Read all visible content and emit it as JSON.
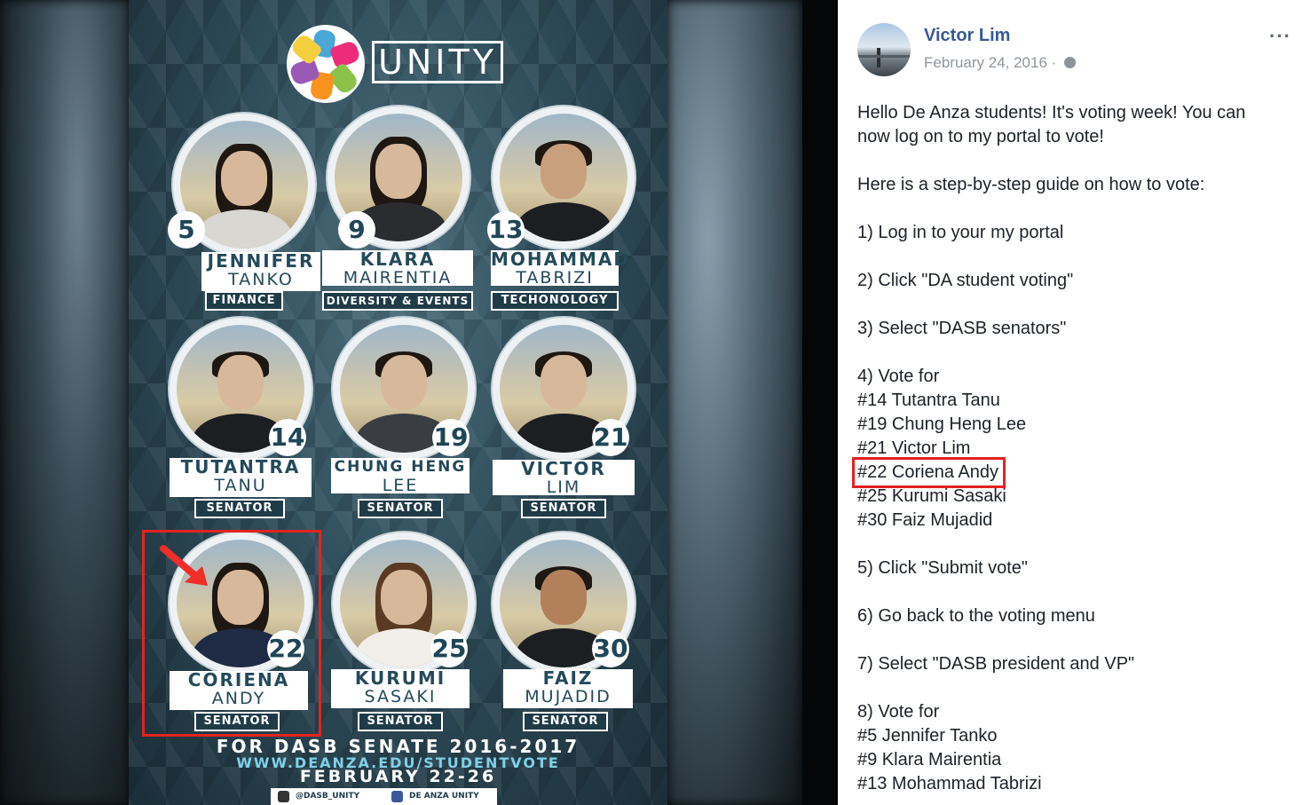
{
  "poster": {
    "title": "UNITY",
    "candidates": [
      {
        "number": "5",
        "first": "JENNIFER",
        "last": "TANKO",
        "role": "FINANCE"
      },
      {
        "number": "9",
        "first": "KLARA",
        "last": "MAIRENTIA",
        "role": "DIVERSITY & EVENTS"
      },
      {
        "number": "13",
        "first": "MOHAMMAD",
        "last": "TABRIZI",
        "role": "TECHONOLOGY"
      },
      {
        "number": "14",
        "first": "TUTANTRA",
        "last": "TANU",
        "role": "SENATOR"
      },
      {
        "number": "19",
        "first": "CHUNG HENG",
        "last": "LEE",
        "role": "SENATOR"
      },
      {
        "number": "21",
        "first": "VICTOR",
        "last": "LIM",
        "role": "SENATOR"
      },
      {
        "number": "22",
        "first": "CORIENA",
        "last": "ANDY",
        "role": "SENATOR"
      },
      {
        "number": "25",
        "first": "KURUMI",
        "last": "SASAKI",
        "role": "SENATOR"
      },
      {
        "number": "30",
        "first": "FAIZ",
        "last": "MUJADID",
        "role": "SENATOR"
      }
    ],
    "footer_line1": "FOR DASB SENATE 2016-2017",
    "footer_line2": "WWW.DEANZA.EDU/STUDENTVOTE",
    "footer_line3": "FEBRUARY 22-26",
    "instagram": "@DASB_UNITY",
    "facebook": "DE ANZA UNITY",
    "highlight_color": "#e3231f"
  },
  "post": {
    "author": "Victor Lim",
    "date": "February 24, 2016 ·",
    "more": "···",
    "lines": [
      "Hello De Anza students! It's voting week! You can",
      "now log on to my portal to vote!",
      "",
      "Here is a step-by-step guide on how to vote:",
      "",
      "1) Log in to your my portal",
      "",
      "2) Click \"DA student voting\"",
      "",
      "3) Select \"DASB senators\"",
      "",
      "4) Vote for",
      "#14 Tutantra Tanu",
      "#19 Chung Heng Lee",
      "#21 Victor Lim",
      "#22 Coriena Andy",
      "#25 Kurumi Sasaki",
      "#30 Faiz Mujadid",
      "",
      "5) Click \"Submit vote\"",
      "",
      "6) Go back to the voting menu",
      "",
      "7) Select \"DASB president and VP\"",
      "",
      "8) Vote for",
      "#5 Jennifer Tanko",
      "#9 Klara Mairentia",
      "#13 Mohammad Tabrizi"
    ],
    "highlighted_line": "#22 Coriena Andy",
    "author_color": "#385898"
  }
}
